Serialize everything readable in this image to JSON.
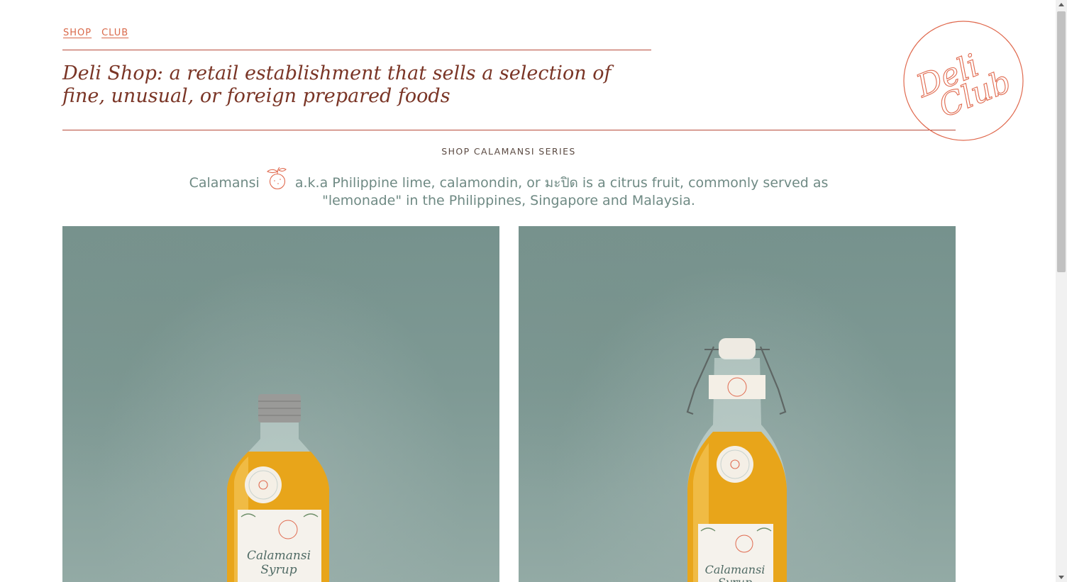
{
  "nav": {
    "items": [
      {
        "label": "SHOP"
      },
      {
        "label": "CLUB"
      }
    ]
  },
  "header": {
    "tagline": "Deli Shop: a retail establishment that sells a selection of fine, unusual, or foreign prepared foods"
  },
  "logo": {
    "text_line1": "Deli",
    "text_line2": "Club"
  },
  "section": {
    "title": "SHOP CALAMANSI SERIES",
    "intro_before": "Calamansi",
    "intro_after": "a.k.a Philippine lime, calamondin, or มะปิด is a citrus fruit, commonly served as \"lemonade\" in the Philippines, Singapore and Malaysia."
  },
  "products": [
    {
      "name": "Calamansi Syrup bottle (screw cap)",
      "label_line1": "Calamansi",
      "label_line2": "Syrup"
    },
    {
      "name": "Calamansi Syrup bottle (swing top)",
      "label_line1": "Calamansi",
      "label_line2": "Syrup"
    }
  ],
  "colors": {
    "accent": "#d9694a",
    "rule": "#b84a3a",
    "tagline": "#7a3526",
    "body_text": "#6f8a84",
    "photo_background": "#7e9994",
    "syrup": "#e8a51a"
  },
  "icons": [
    "calamansi-fruit-icon",
    "deli-club-logo"
  ]
}
